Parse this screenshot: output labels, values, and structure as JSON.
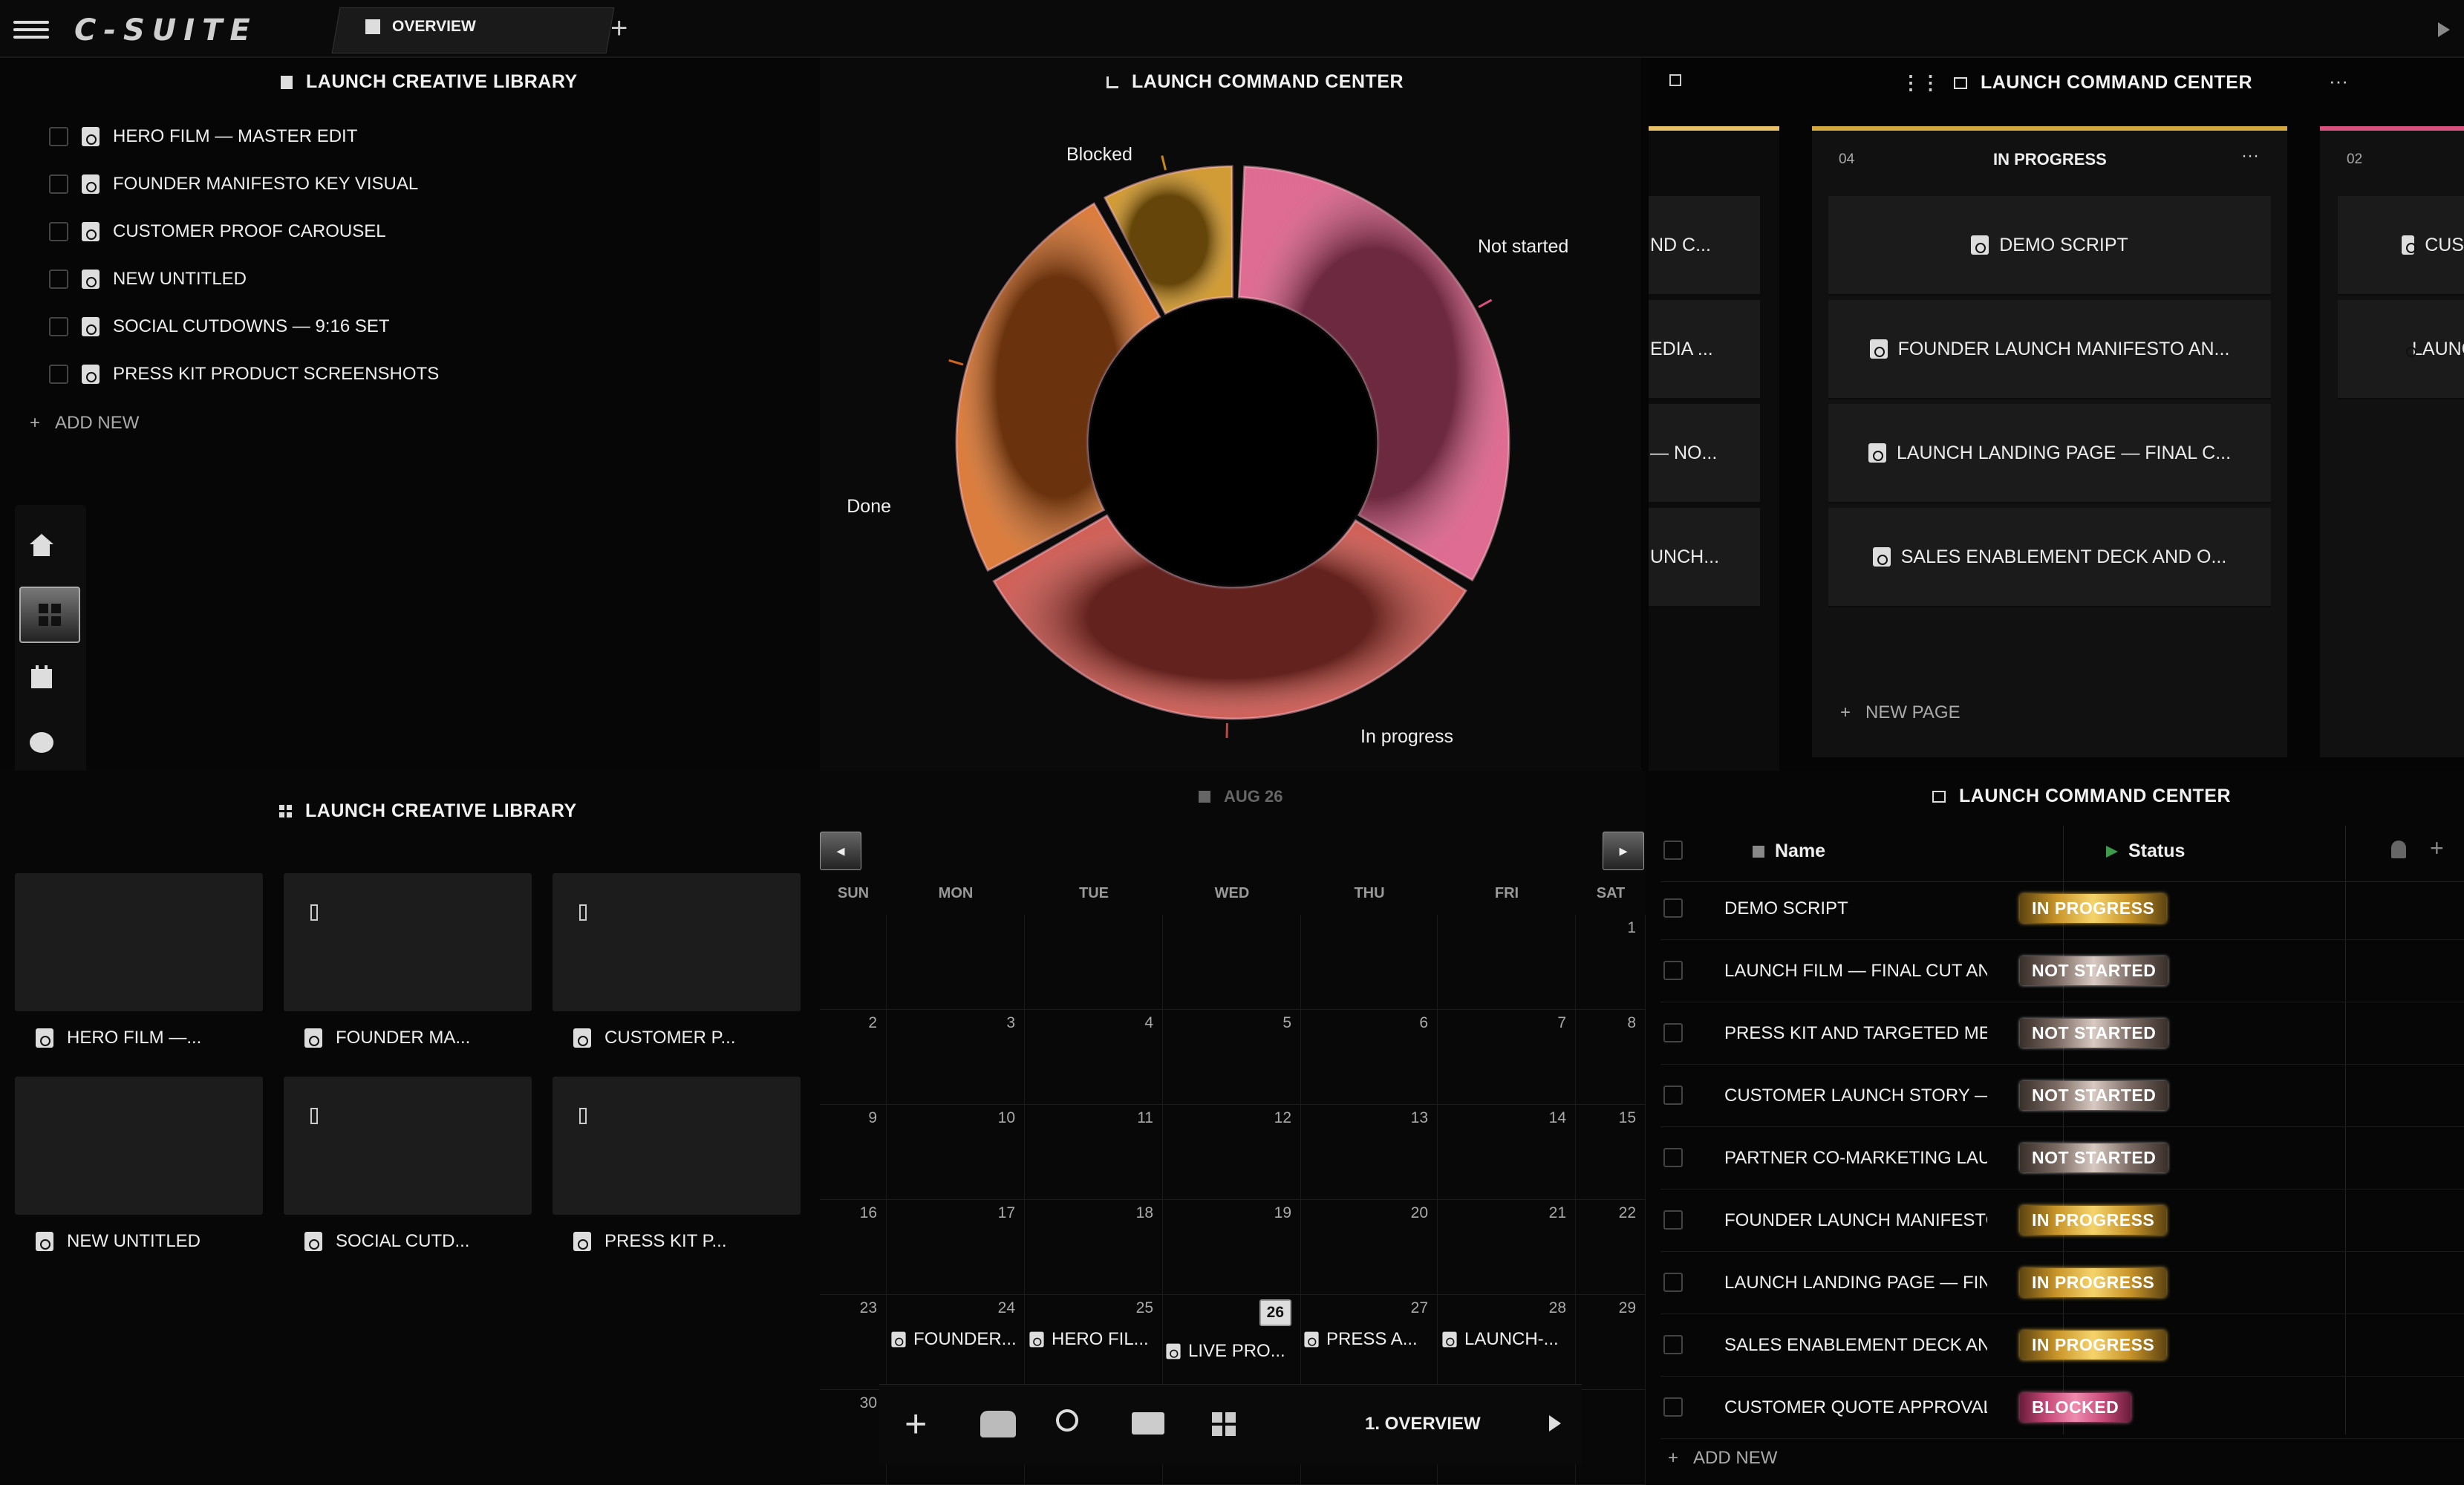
{
  "app": {
    "logo": "C-SUITE",
    "tab_label": "OVERVIEW"
  },
  "library_top": {
    "title": "LAUNCH CREATIVE LIBRARY",
    "items": [
      "HERO FILM — MASTER EDIT",
      "FOUNDER MANIFESTO KEY VISUAL",
      "CUSTOMER PROOF CAROUSEL",
      "NEW UNTITLED",
      "SOCIAL CUTDOWNS — 9:16 SET",
      "PRESS KIT PRODUCT SCREENSHOTS"
    ],
    "add_new": "ADD NEW"
  },
  "chart_panel": {
    "title": "LAUNCH COMMAND CENTER"
  },
  "chart_data": {
    "type": "pie",
    "title": "",
    "categories": [
      "Not started",
      "In progress",
      "Done",
      "Blocked"
    ],
    "values": [
      4,
      4,
      3,
      1
    ],
    "colors": [
      "#d9527f",
      "#c8453c",
      "#d4661c",
      "#c98a12"
    ],
    "donut": true
  },
  "kanban": {
    "title": "LAUNCH COMMAND CENTER",
    "left_cards": [
      "ND C...",
      "EDIA ...",
      "— NO...",
      "UNCH..."
    ],
    "column": {
      "count": "04",
      "label": "IN PROGRESS",
      "cards": [
        "DEMO SCRIPT",
        "FOUNDER LAUNCH MANIFESTO AN...",
        "LAUNCH LANDING PAGE — FINAL C...",
        "SALES ENABLEMENT DECK AND O..."
      ],
      "new_page": "NEW PAGE"
    },
    "right_column": {
      "count": "02",
      "cards": [
        "CUS",
        "LAUNC"
      ]
    }
  },
  "library_grid": {
    "title": "LAUNCH CREATIVE LIBRARY",
    "tiles": [
      "HERO FILM —...",
      "FOUNDER MA...",
      "CUSTOMER P...",
      "NEW UNTITLED",
      "SOCIAL CUTD...",
      "PRESS KIT P..."
    ]
  },
  "calendar": {
    "month": "AUG 26",
    "weekdays": [
      "SUN",
      "MON",
      "TUE",
      "WED",
      "THU",
      "FRI",
      "SAT"
    ],
    "weeks": [
      [
        "",
        "",
        "",
        "",
        "",
        "",
        "1"
      ],
      [
        "2",
        "3",
        "4",
        "5",
        "6",
        "7",
        "8"
      ],
      [
        "9",
        "10",
        "11",
        "12",
        "13",
        "14",
        "15"
      ],
      [
        "16",
        "17",
        "18",
        "19",
        "20",
        "21",
        "22"
      ],
      [
        "23",
        "24",
        "25",
        "26",
        "27",
        "28",
        "29"
      ],
      [
        "30",
        "",
        "",
        "",
        "",
        "",
        ""
      ]
    ],
    "events": [
      "FOUNDER...",
      "HERO FIL...",
      "LIVE PRO...",
      "PRESS A...",
      "LAUNCH-..."
    ],
    "today": "26"
  },
  "toolbar": {
    "page_label": "1. OVERVIEW"
  },
  "table": {
    "title": "LAUNCH COMMAND CENTER",
    "col_name": "Name",
    "col_status": "Status",
    "rows": [
      {
        "name": "DEMO SCRIPT",
        "status": "IN PROGRESS"
      },
      {
        "name": "LAUNCH FILM — FINAL CUT AND CAPT",
        "status": "NOT STARTED"
      },
      {
        "name": "PRESS KIT AND TARGETED MEDIA LIS",
        "status": "NOT STARTED"
      },
      {
        "name": "CUSTOMER LAUNCH STORY — NORT",
        "status": "NOT STARTED"
      },
      {
        "name": "PARTNER CO-MARKETING LAUNCH K",
        "status": "NOT STARTED"
      },
      {
        "name": "FOUNDER LAUNCH MANIFESTO AND :",
        "status": "IN PROGRESS"
      },
      {
        "name": "LAUNCH LANDING PAGE — FINAL COI",
        "status": "IN PROGRESS"
      },
      {
        "name": "SALES ENABLEMENT DECK AND OBJE",
        "status": "IN PROGRESS"
      },
      {
        "name": "CUSTOMER QUOTE APPROVALS",
        "status": "BLOCKED"
      }
    ],
    "add_new": "ADD NEW"
  }
}
